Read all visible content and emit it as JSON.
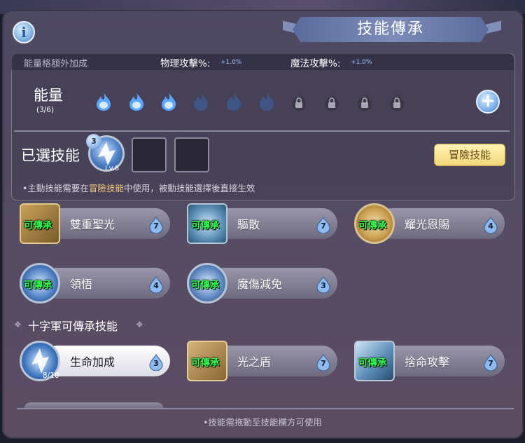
{
  "header": {
    "title": "技能傳承",
    "info_icon": "info-icon",
    "info_symbol": "i"
  },
  "bonus": {
    "label": "能量格額外加成",
    "physical_label": "物理攻擊%:",
    "physical_value": "+1.0%",
    "magic_label": "魔法攻擊%:",
    "magic_value": "+1.0%"
  },
  "energy": {
    "label": "能量",
    "count": "(3/6)",
    "slots": [
      "filled",
      "filled",
      "filled",
      "empty",
      "empty",
      "empty",
      "locked",
      "locked",
      "locked",
      "locked"
    ],
    "add_symbol": "+"
  },
  "selected": {
    "label": "已選技能",
    "skill_badge": "3",
    "skill_level": "Lv.8",
    "adventure_button": "冒險技能",
    "note_prefix": "•主動技能需要在",
    "note_highlight": "冒險技能",
    "note_suffix": "中使用，被動技能選擇後直接生效"
  },
  "inheritable": [
    {
      "name": "雙重聖光",
      "tag": "可傳承",
      "cost": "7"
    },
    {
      "name": "驅散",
      "tag": "可傳承",
      "cost": "7"
    },
    {
      "name": "耀光恩賜",
      "tag": "可傳承",
      "cost": "4"
    },
    {
      "name": "領悟",
      "tag": "可傳承",
      "cost": "4"
    },
    {
      "name": "魔傷減免",
      "tag": "可傳承",
      "cost": "3"
    }
  ],
  "crusader": {
    "title": "十字軍可傳承技能",
    "skills": [
      {
        "name": "生命加成",
        "progress": "8/10",
        "cost": "3",
        "active": true
      },
      {
        "name": "光之盾",
        "tag": "可傳承",
        "cost": "7"
      },
      {
        "name": "捨命攻擊",
        "tag": "可傳承",
        "cost": "7"
      }
    ]
  },
  "footer": {
    "note": "•技能需拖動至技能欄方可使用"
  },
  "colors": {
    "inherit_tag": "#33ff4f",
    "energy_filled": "#5aa6ff",
    "button_gold": "#f2d77a"
  }
}
